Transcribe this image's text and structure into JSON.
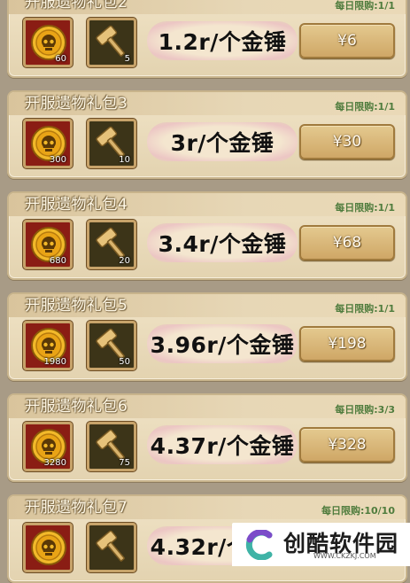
{
  "packs": [
    {
      "title": "开服遗物礼包2",
      "limit": "每日限购:1/1",
      "coin_qty": "60",
      "hammer_qty": "5",
      "rate": "1.2r/个金锤",
      "price": "¥6"
    },
    {
      "title": "开服遗物礼包3",
      "limit": "每日限购:1/1",
      "coin_qty": "300",
      "hammer_qty": "10",
      "rate": "3r/个金锤",
      "price": "¥30"
    },
    {
      "title": "开服遗物礼包4",
      "limit": "每日限购:1/1",
      "coin_qty": "680",
      "hammer_qty": "20",
      "rate": "3.4r/个金锤",
      "price": "¥68"
    },
    {
      "title": "开服遗物礼包5",
      "limit": "每日限购:1/1",
      "coin_qty": "1980",
      "hammer_qty": "50",
      "rate": "3.96r/个金锤",
      "price": "¥198"
    },
    {
      "title": "开服遗物礼包6",
      "limit": "每日限购:3/3",
      "coin_qty": "3280",
      "hammer_qty": "75",
      "rate": "4.37r/个金锤",
      "price": "¥328"
    },
    {
      "title": "开服遗物礼包7",
      "limit": "每日限购:10/10",
      "coin_qty": "",
      "hammer_qty": "",
      "rate": "4.32r/个金锤",
      "price": ""
    }
  ],
  "watermark": {
    "name": "创酷软件园",
    "url": "WWW.CKZKJ.COM"
  },
  "icons": {
    "currency": "skull-coin-icon",
    "item": "golden-hammer-icon",
    "watermark": "brand-logo-icon"
  },
  "colors": {
    "panel": "#e9dabb",
    "title_text": "#fff8e6",
    "limit_text": "#4f7c3d",
    "price_button": "#d8b577",
    "coin_bg": "#8a1d14",
    "hammer_bg": "#3c3418"
  }
}
